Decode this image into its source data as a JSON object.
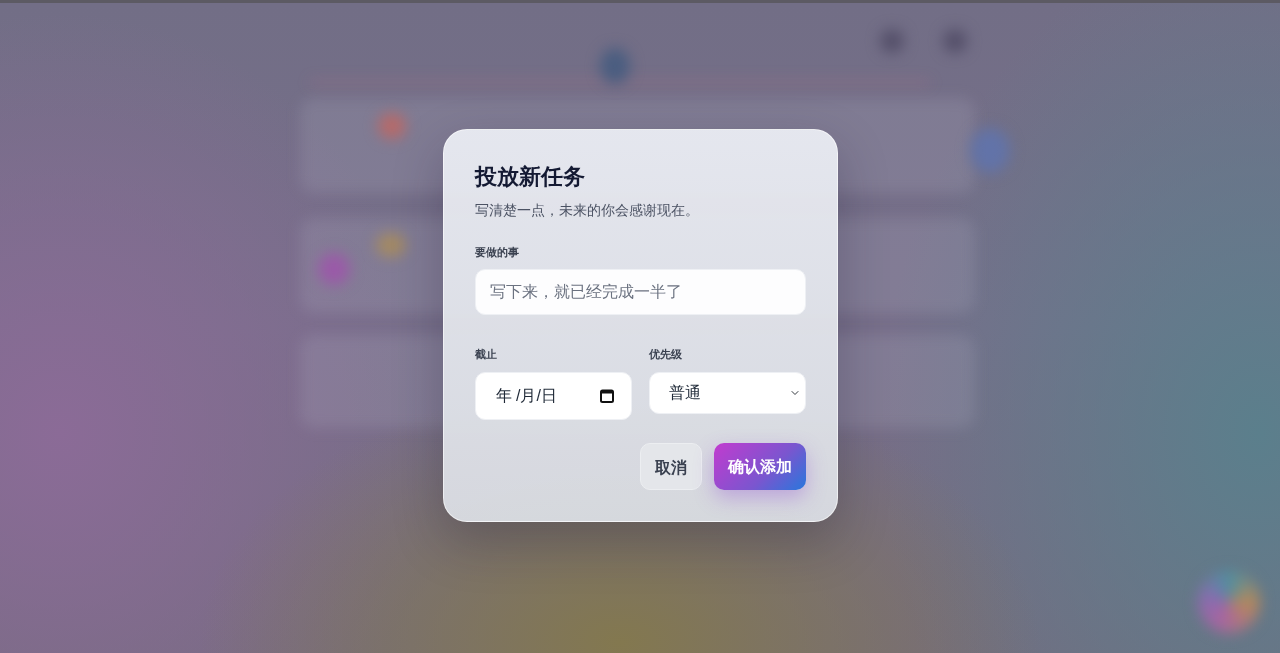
{
  "dialog": {
    "title": "投放新任务",
    "subtitle": "写清楚一点，未来的你会感谢现在。",
    "fields": [
      {
        "kind": "text",
        "label": "要做的事",
        "placeholder": "写下来，就已经完成一半了"
      },
      {
        "kind": "date",
        "label": "截止",
        "placeholder": "年 /月/日"
      },
      {
        "kind": "select",
        "label": "优先级",
        "value": "普通"
      }
    ],
    "buttons": [
      {
        "kind": "secondary",
        "label": "取消"
      },
      {
        "kind": "primary",
        "label": "确认添加"
      }
    ]
  }
}
